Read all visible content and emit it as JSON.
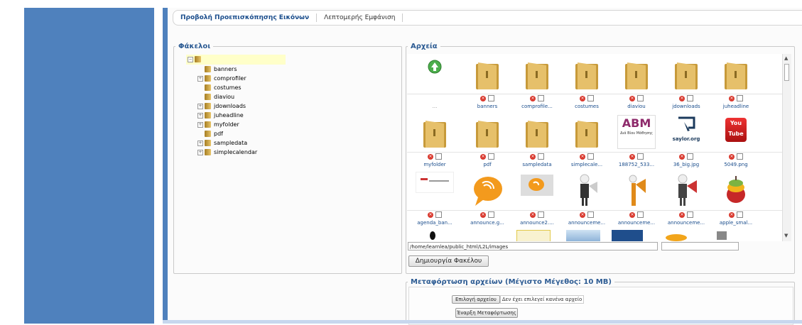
{
  "tabs": [
    {
      "label": "Προβολή Προεπισκόπησης Εικόνων"
    },
    {
      "label": "Λεπτομερής Εμφάνιση"
    }
  ],
  "folders": {
    "legend": "Φάκελοι",
    "items": [
      "banners",
      "comprofiler",
      "costumes",
      "diaviou",
      "jdownloads",
      "juheadline",
      "myfolder",
      "pdf",
      "sampledata",
      "simplecalendar"
    ]
  },
  "files": {
    "legend": "Αρχεία",
    "up_label": "...",
    "row1": [
      "banners",
      "comprofile...",
      "costumes",
      "diaviou",
      "jdownloads",
      "juheadline"
    ],
    "row2": [
      "myfolder",
      "pdf",
      "sampledata",
      "simplecale...",
      "188752_533...",
      "36_big.jpg",
      "5049.png"
    ],
    "row3": [
      "agenda_ban...",
      "announce.g...",
      "announce2....",
      "announceme...",
      "announceme...",
      "announceme...",
      "apple_smal..."
    ],
    "thumb_text": {
      "abm": "ABM",
      "abm_sub": "Διά Βίου Μάθησης",
      "saylor": "saylor.org",
      "youtube": "You Tube"
    }
  },
  "path": {
    "value": "/home/learnlea/public_html/L2L/images"
  },
  "create_folder_label": "Δημιουργία Φακέλου",
  "upload": {
    "legend": "Μεταφόρτωση αρχείων (Μέγιστο Μέγεθος: 10 MB)",
    "choose_label": "Επιλογή αρχείου",
    "no_file_text": "Δεν έχει επιλεγεί κανένα αρχείο",
    "start_label": "Έναρξη Μεταφόρτωσης"
  },
  "colors": {
    "accent": "#4f81bd",
    "link": "#1a4d8c"
  }
}
